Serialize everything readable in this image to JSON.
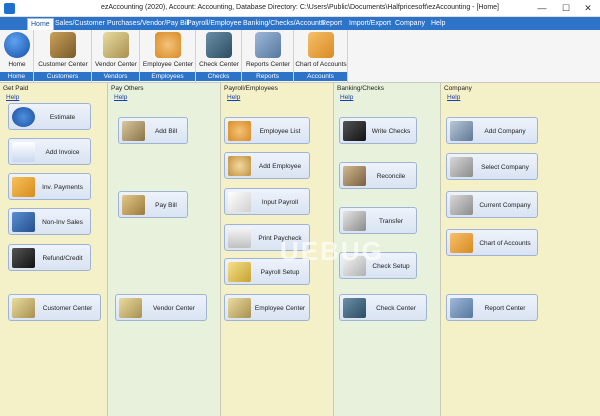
{
  "window": {
    "title": "ezAccounting (2020), Account: Accounting, Database Directory: C:\\Users\\Public\\Documents\\Halfpricesoft\\ezAccounting - [Home]",
    "min": "—",
    "max": "☐",
    "close": "✕"
  },
  "menu": [
    "Home",
    "Sales/Customer",
    "Purchases/Vendor/Pay Bill",
    "Payroll/Employee",
    "Banking/Checks/Accounts",
    "Report",
    "Import/Export",
    "Company",
    "Help"
  ],
  "ribbon": {
    "groups": [
      {
        "caption": "Home",
        "buttons": [
          "Home"
        ]
      },
      {
        "caption": "Customers",
        "buttons": [
          "Customer Center"
        ]
      },
      {
        "caption": "Vendors",
        "buttons": [
          "Vendor Center"
        ]
      },
      {
        "caption": "Employees",
        "buttons": [
          "Employee Center"
        ]
      },
      {
        "caption": "Checks",
        "buttons": [
          "Check Center"
        ]
      },
      {
        "caption": "Reports",
        "buttons": [
          "Reports Center"
        ]
      },
      {
        "caption": "Accounts",
        "buttons": [
          "Chart of Accounts"
        ]
      }
    ]
  },
  "panels": {
    "get_paid": {
      "title": "Get Paid",
      "help": "Help",
      "items": [
        "Estimate",
        "Add Invoice",
        "Inv. Payments",
        "Non-Inv Sales",
        "Refund/Credit",
        "Customer Center"
      ]
    },
    "pay_others": {
      "title": "Pay Others",
      "help": "Help",
      "items": [
        "Add Bill",
        "Pay Bill",
        "Vendor Center"
      ]
    },
    "payroll": {
      "title": "Payroll/Employees",
      "help": "Help",
      "items": [
        "Employee List",
        "Add Employee",
        "Input Payroll",
        "Print Paycheck",
        "Payroll Setup",
        "Employee Center"
      ]
    },
    "banking": {
      "title": "Banking/Checks",
      "help": "Help",
      "items": [
        "Write Checks",
        "Reconcile",
        "Transfer",
        "Check Setup",
        "Check Center"
      ]
    },
    "company": {
      "title": "Company",
      "help": "Help",
      "items": [
        "Add Company",
        "Select Company",
        "Current Company",
        "Chart of Accounts",
        "Report Center"
      ]
    }
  },
  "colors": {
    "menubar": "#2d73c8",
    "background": "#f6f4d8"
  },
  "watermark": "UEBUG"
}
